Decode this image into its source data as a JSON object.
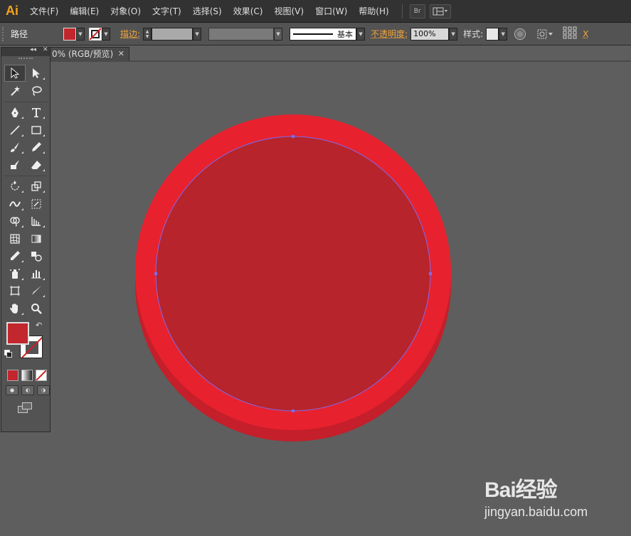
{
  "app": {
    "logo_text": "Ai"
  },
  "menu": {
    "items": [
      "文件(F)",
      "编辑(E)",
      "对象(O)",
      "文字(T)",
      "选择(S)",
      "效果(C)",
      "视图(V)",
      "窗口(W)",
      "帮助(H)"
    ],
    "bridge_label": "Br"
  },
  "control_bar": {
    "selection_type": "路径",
    "fill_color": "#c1272d",
    "stroke_label": "描边:",
    "stroke_profile_label": "基本",
    "opacity_label": "不透明度:",
    "opacity_value": "100%",
    "style_label": "样式:"
  },
  "document": {
    "tab_title": "0% (RGB/预览)",
    "close_glyph": "✕"
  },
  "tools": {
    "fill_color": "#c1272d"
  },
  "artwork": {
    "outer_color": "#e8212e",
    "outer_shadow_color": "#c41f2a",
    "inner_color": "#b7242c",
    "selection_color": "#7b6cf0",
    "canvas_color": "#5e5e5e"
  },
  "watermark": {
    "logo": "Bai经验",
    "url": "jingyan.baidu.com"
  }
}
